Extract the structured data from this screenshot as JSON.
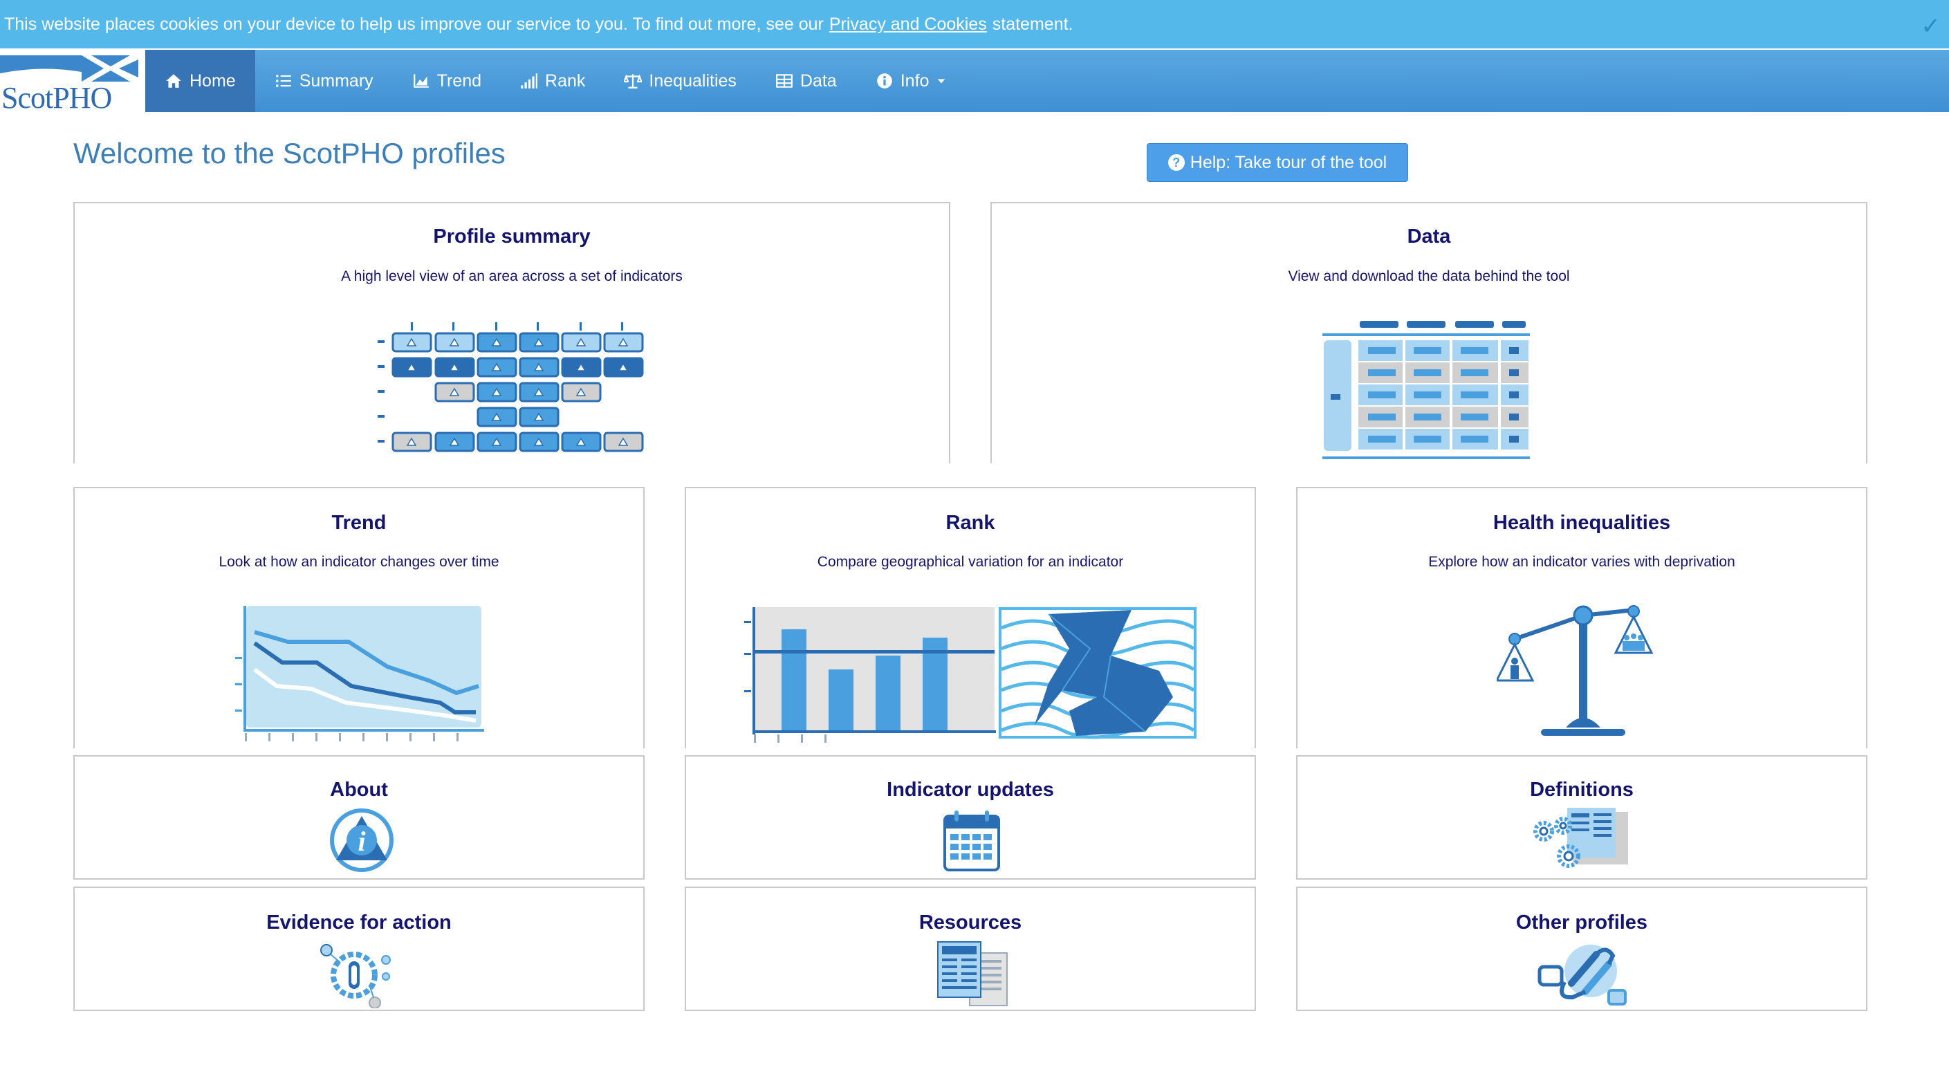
{
  "cookie": {
    "text": "This website places cookies on your device to help us improve our service to you. To find out more, see our",
    "link": "Privacy and Cookies",
    "suffix": "statement.",
    "close": "✓"
  },
  "logo": {
    "text": "ScotPHO"
  },
  "nav": {
    "items": [
      {
        "label": "Home",
        "icon": "home-icon"
      },
      {
        "label": "Summary",
        "icon": "list-icon"
      },
      {
        "label": "Trend",
        "icon": "area-chart-icon"
      },
      {
        "label": "Rank",
        "icon": "signal-icon"
      },
      {
        "label": "Inequalities",
        "icon": "balance-scale-icon"
      },
      {
        "label": "Data",
        "icon": "table-icon"
      },
      {
        "label": "Info",
        "icon": "info-circle-icon"
      }
    ],
    "active": "Home"
  },
  "page": {
    "title": "Welcome to the ScotPHO profiles",
    "help_button": "Help: Take tour of the tool"
  },
  "tiles": {
    "profile_summary": {
      "title": "Profile summary",
      "desc": "A high level view of an area across a set of indicators"
    },
    "data": {
      "title": "Data",
      "desc": "View and download the data behind the tool"
    },
    "trend": {
      "title": "Trend",
      "desc": "Look at how an indicator changes over time"
    },
    "rank": {
      "title": "Rank",
      "desc": "Compare geographical variation for an indicator"
    },
    "inequalities": {
      "title": "Health inequalities",
      "desc": "Explore how an indicator varies with deprivation"
    },
    "about": {
      "title": "About"
    },
    "updates": {
      "title": "Indicator updates"
    },
    "definitions": {
      "title": "Definitions"
    },
    "evidence": {
      "title": "Evidence for action"
    },
    "resources": {
      "title": "Resources"
    },
    "other": {
      "title": "Other profiles"
    }
  },
  "colors": {
    "cookie_bar": "#55b8eb",
    "navbar": "#4a9ad9",
    "active_nav": "#3674b5",
    "title": "#3d7fb8",
    "tile_heading": "#14146e",
    "help_button": "#4c9fe8"
  }
}
